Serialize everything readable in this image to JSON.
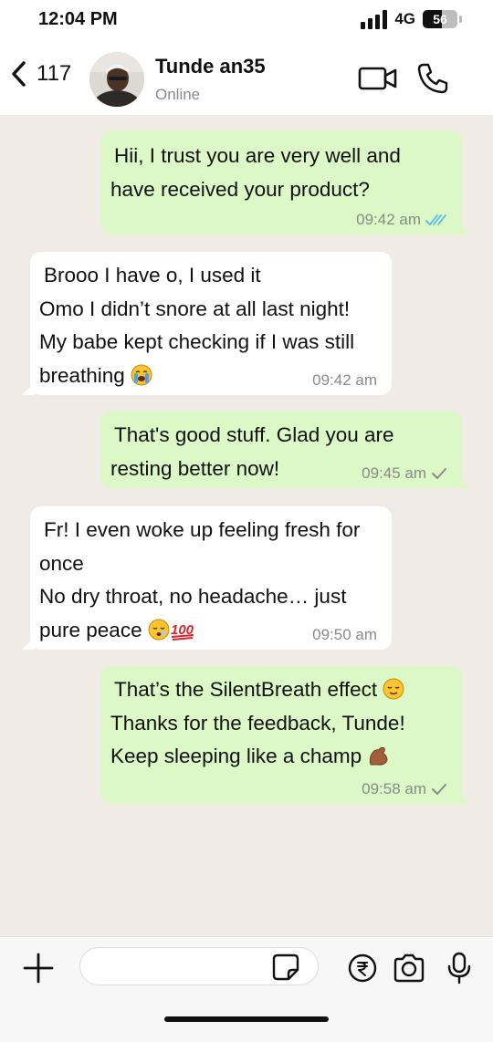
{
  "status_bar": {
    "time": "12:04 PM",
    "network": "4G",
    "battery": "56",
    "battery_level": 0.56
  },
  "header": {
    "back_count": "117",
    "contact_name": "Tunde an35",
    "contact_status": "Online"
  },
  "messages": [
    {
      "direction": "out",
      "lines": [
        "Hii, I trust you are very well and",
        "have received your product?"
      ],
      "time": "09:42 am",
      "status": "read"
    },
    {
      "direction": "in",
      "lines": [
        "Brooo I have o, I used it",
        "Omo I didn’t snore at all last night!",
        "My babe kept checking if I was still",
        "breathing"
      ],
      "emoji": [
        "crying-face"
      ],
      "time": "09:42 am"
    },
    {
      "direction": "out",
      "lines": [
        "That's good stuff. Glad you are",
        "resting better now!"
      ],
      "time": "09:45 am",
      "status": "sent"
    },
    {
      "direction": "in",
      "lines": [
        "Fr! I even woke up feeling fresh for",
        "once",
        "No dry throat, no headache… just",
        "pure peace"
      ],
      "emoji": [
        "sleeping-face",
        "hundred-points"
      ],
      "time": "09:50 am"
    },
    {
      "direction": "out",
      "lines": [
        "That’s the SilentBreath effect",
        "Thanks for the feedback, Tunde!",
        "Keep sleeping like a champ"
      ],
      "emoji": [
        "relieved-face",
        "flexed-biceps"
      ],
      "time": "09:58 am",
      "status": "sent"
    }
  ],
  "composer": {
    "placeholder": ""
  },
  "colors": {
    "outgoing": "#dcf8c6",
    "incoming": "#ffffff",
    "chat_bg": "#f0ebe5",
    "read_tick": "#53bdeb",
    "sent_tick": "#8a8a8a"
  },
  "icons": [
    "chevron-left-icon",
    "video-icon",
    "phone-icon",
    "plus-icon",
    "sticker-icon",
    "rupee-icon",
    "camera-icon",
    "mic-icon"
  ]
}
